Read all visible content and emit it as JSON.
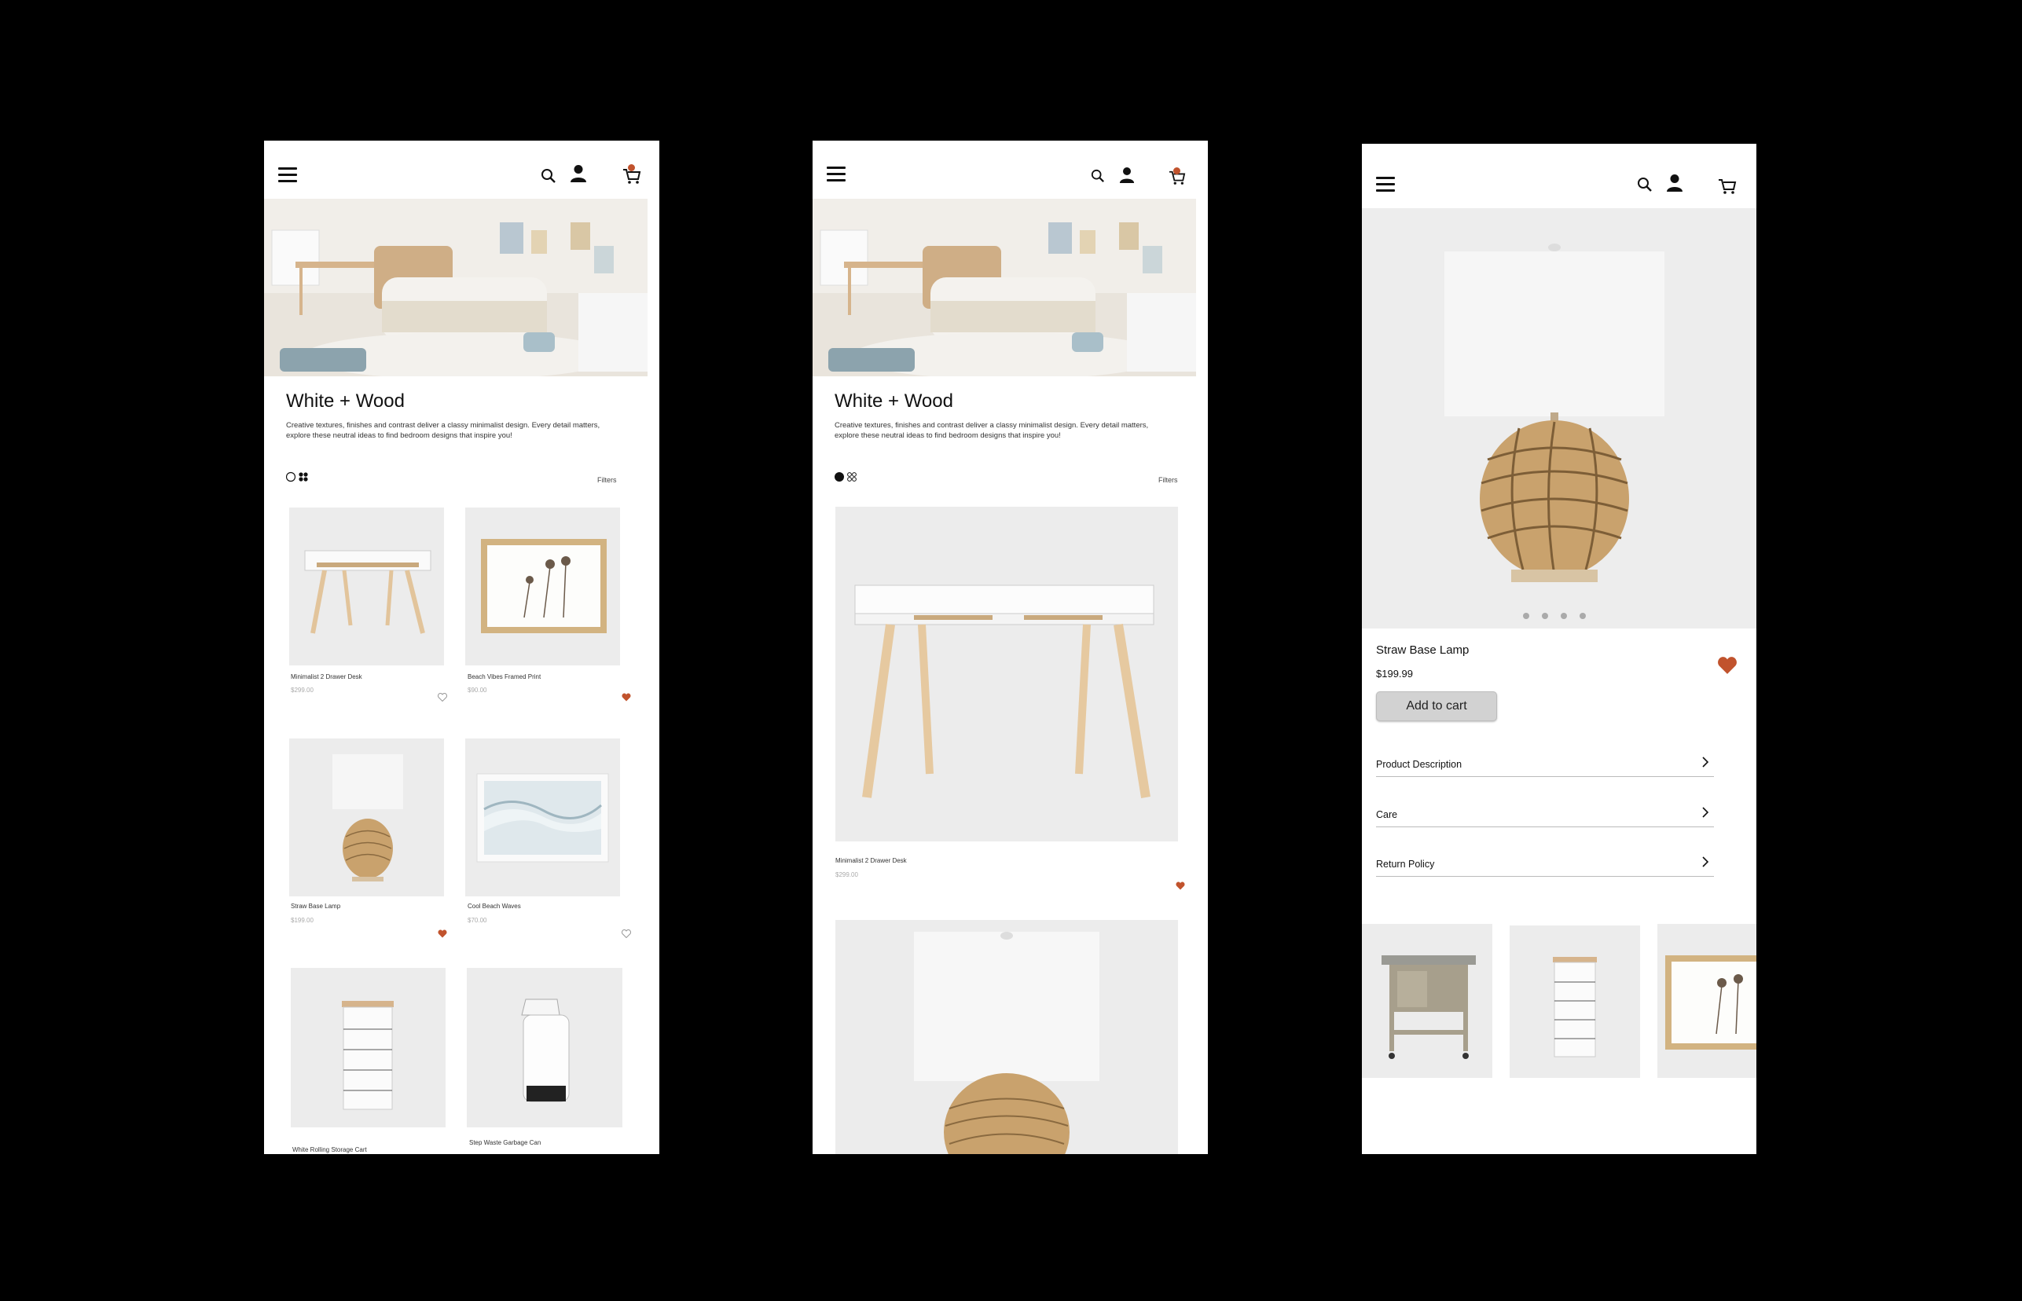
{
  "colors": {
    "accent": "#c1532d",
    "background": "#000000",
    "card_bg": "#ececec"
  },
  "header": {
    "menu_icon": "hamburger-menu-icon",
    "search_icon": "search-icon",
    "account_icon": "user-icon",
    "cart_icon": "cart-icon"
  },
  "collection": {
    "title": "White + Wood",
    "description": "Creative textures, finishes and contrast deliver a classy minimalist design. Every detail matters, explore these neutral ideas to find bedroom designs that inspire you!",
    "filters_label": "Filters"
  },
  "grid_products": [
    {
      "name": "Minimalist 2 Drawer Desk",
      "price": "$299.00",
      "favorited": false
    },
    {
      "name": "Beach Vibes Framed Print",
      "price": "$90.00",
      "favorited": true
    },
    {
      "name": "Straw Base Lamp",
      "price": "$199.00",
      "favorited": true
    },
    {
      "name": "Cool Beach Waves",
      "price": "$70.00",
      "favorited": false
    },
    {
      "name": "White Rolling Storage Cart",
      "price": "",
      "favorited": false
    },
    {
      "name": "Step Waste Garbage Can",
      "price": "",
      "favorited": false
    }
  ],
  "list_view": {
    "product": {
      "name": "Minimalist 2 Drawer Desk",
      "price": "$299.00",
      "favorited": true
    }
  },
  "detail": {
    "name": "Straw Base Lamp",
    "price": "$199.99",
    "favorited": true,
    "add_to_cart": "Add to cart",
    "carousel_dots": 4,
    "sections": [
      "Product Description",
      "Care",
      "Return Policy"
    ]
  }
}
